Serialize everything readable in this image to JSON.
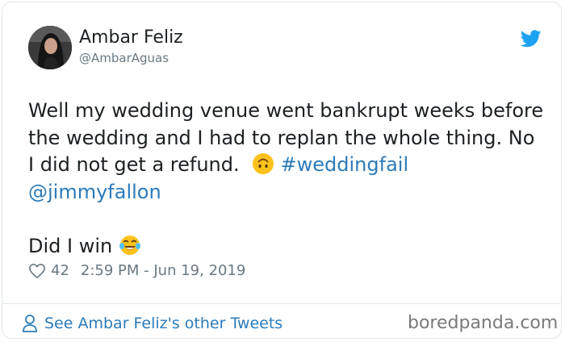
{
  "author": {
    "name": "Ambar Feliz",
    "handle": "@AmbarAguas"
  },
  "icons": {
    "brand": "twitter-bird-icon",
    "upside_down_face": "upside-down-face-emoji",
    "tears_of_joy": "face-with-tears-of-joy-emoji",
    "like": "heart-outline-icon",
    "profile": "person-outline-icon"
  },
  "tweet": {
    "text_part1": "Well my wedding venue went bankrupt weeks before the wedding and I had to replan the whole thing. No I did not get a refund.",
    "hashtag": "#weddingfail",
    "mention": "@jimmyfallon",
    "text_part2": "Did I win"
  },
  "meta": {
    "likes": "42",
    "timestamp": "2:59 PM - Jun 19, 2019"
  },
  "footer": {
    "link_text": "See Ambar Feliz's other Tweets",
    "watermark": "boredpanda.com"
  },
  "colors": {
    "link": "#2b7bb9",
    "twitter_blue": "#1da1f2",
    "text": "#1c2022",
    "muted": "#697882"
  }
}
